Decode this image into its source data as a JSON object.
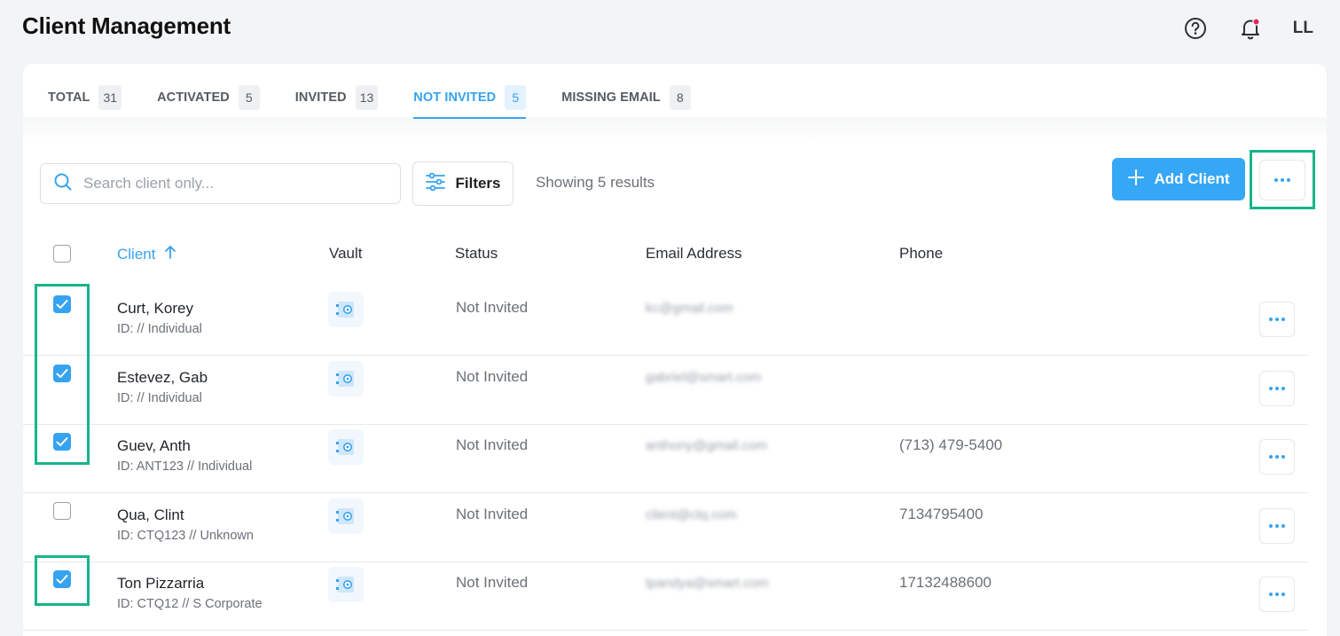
{
  "header": {
    "title": "Client Management",
    "avatar_initials": "LL",
    "icons": [
      "help-icon",
      "bell-icon"
    ]
  },
  "tabs": [
    {
      "label": "TOTAL",
      "count": "31",
      "active": false
    },
    {
      "label": "ACTIVATED",
      "count": "5",
      "active": false
    },
    {
      "label": "INVITED",
      "count": "13",
      "active": false
    },
    {
      "label": "NOT INVITED",
      "count": "5",
      "active": true
    },
    {
      "label": "MISSING EMAIL",
      "count": "8",
      "active": false
    }
  ],
  "toolbar": {
    "search_placeholder": "Search client only...",
    "filters_label": "Filters",
    "showing_text": "Showing 5 results",
    "add_client_label": "Add Client"
  },
  "table": {
    "columns": {
      "client": "Client",
      "vault": "Vault",
      "status": "Status",
      "email": "Email Address",
      "phone": "Phone"
    },
    "rows": [
      {
        "name": "Curt, Korey",
        "sub": "ID: // Individual",
        "status": "Not Invited",
        "email": "kc@gmail.com",
        "phone": "",
        "checked": true
      },
      {
        "name": "Estevez, Gab",
        "sub": "ID: // Individual",
        "status": "Not Invited",
        "email": "gabriel@smart.com",
        "phone": "",
        "checked": true
      },
      {
        "name": "Guev, Anth",
        "sub": "ID: ANT123 // Individual",
        "status": "Not Invited",
        "email": "anthony@gmail.com",
        "phone": "(713) 479-5400",
        "checked": true
      },
      {
        "name": "Qua, Clint",
        "sub": "ID: CTQ123 // Unknown",
        "status": "Not Invited",
        "email": "client@ctq.com",
        "phone": "7134795400",
        "checked": false
      },
      {
        "name": "Ton Pizzarria",
        "sub": "ID: CTQ12 // S Corporate",
        "status": "Not Invited",
        "email": "tpandya@smart.com",
        "phone": "17132488600",
        "checked": true
      }
    ]
  },
  "colors": {
    "accent": "#36a3f0",
    "highlight": "#17b38a",
    "notification_dot": "#e0245e"
  }
}
